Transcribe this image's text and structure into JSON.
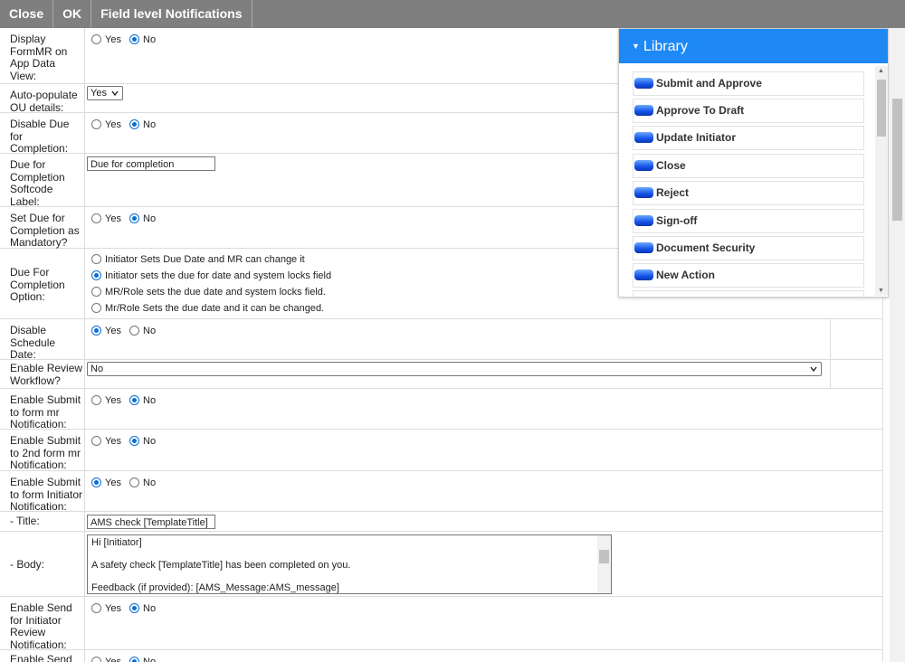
{
  "toolbar": {
    "close": "Close",
    "ok": "OK",
    "title": "Field level Notifications"
  },
  "opts": {
    "yes": "Yes",
    "no": "No"
  },
  "rows": {
    "display_formmr": "Display FormMR on App Data View:",
    "auto_populate": "Auto-populate OU details:",
    "auto_populate_value": "Yes",
    "disable_due": "Disable Due for Completion:",
    "due_softcode": "Due for Completion Softcode Label:",
    "due_softcode_value": "Due for completion",
    "set_due_mandatory": "Set Due for Completion as Mandatory?",
    "due_option": "Due For Completion Option:",
    "due_option_1": "Initiator Sets Due Date and MR can change it",
    "due_option_2": "Initiator sets the due for date and system locks field",
    "due_option_3": "MR/Role sets the due date and system locks field.",
    "due_option_4": "Mr/Role Sets the due date and it can be changed.",
    "disable_schedule": "Disable Schedule Date:",
    "enable_review": "Enable Review Workflow?",
    "enable_review_value": "No",
    "submit_form_mr": "Enable Submit to form mr Notification:",
    "submit_2nd_form_mr": "Enable Submit to 2nd form mr Notification:",
    "submit_initiator": "Enable Submit to form Initiator Notification:",
    "title_label": "- Title:",
    "title_value": "AMS check [TemplateTitle]",
    "body_label": "- Body:",
    "body_line1": "Hi [Initiator]",
    "body_line2": "A safety check [TemplateTitle] has been completed on you.",
    "body_line3": "Feedback (if provided): [AMS_Message:AMS_message]",
    "send_initiator_review": "Enable Send for Initiator Review Notification:",
    "send_partial": "Enable Send"
  },
  "library": {
    "title": "Library",
    "items": [
      "Submit and Approve",
      "Approve To Draft",
      "Update Initiator",
      "Close",
      "Reject",
      "Sign-off",
      "Document Security",
      "New Action"
    ]
  },
  "colors": {
    "toolbar": "#7f7f7f",
    "library_header": "#1e88f5",
    "radio_checked": "#0a6ed1"
  }
}
